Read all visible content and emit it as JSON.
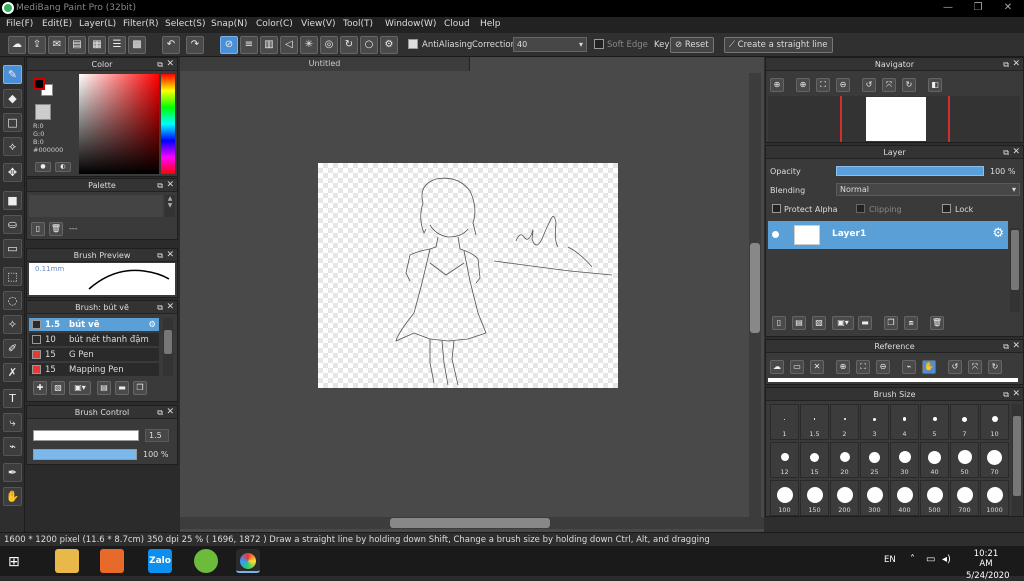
{
  "window": {
    "title": "MediBang Paint Pro (32bit)",
    "min": "—",
    "restore": "❐",
    "close": "✕"
  },
  "menu": [
    "File(F)",
    "Edit(E)",
    "Layer(L)",
    "Filter(R)",
    "Select(S)",
    "Snap(N)",
    "Color(C)",
    "View(V)",
    "Tool(T)",
    "Window(W)",
    "Cloud",
    "Help"
  ],
  "toolbar": {
    "antialias_label": "AntiAliasing",
    "correction_label": "Correction",
    "correction_value": "40",
    "soft_edge_label": "Soft Edge",
    "key_label": "Key",
    "reset_label": "Reset",
    "straight_line_label": "Create a straight line"
  },
  "document": {
    "tab_title": "Untitled"
  },
  "color_panel": {
    "title": "Color",
    "r": "R:0",
    "g": "G:0",
    "b": "B:0",
    "hex": "#000000",
    "foreground": "#000000",
    "background": "#ffffff"
  },
  "palette_panel": {
    "title": "Palette",
    "item": "---"
  },
  "brush_preview": {
    "title": "Brush Preview",
    "size": "0.11mm"
  },
  "brush_panel": {
    "title": "Brush: bút vẽ",
    "brushes": [
      {
        "size": "1.5",
        "name": "bút vẽ",
        "color": "#2a2a2a",
        "selected": true
      },
      {
        "size": "10",
        "name": "bút nét thanh đậm",
        "color": "#2a2a2a",
        "selected": false
      },
      {
        "size": "15",
        "name": "G Pen",
        "color": "#e53935",
        "selected": false
      },
      {
        "size": "15",
        "name": "Mapping Pen",
        "color": "#e53935",
        "selected": false
      }
    ]
  },
  "brush_control": {
    "title": "Brush Control",
    "size_value": "1.5",
    "opacity_value": "100 %"
  },
  "navigator": {
    "title": "Navigator"
  },
  "layer_panel": {
    "title": "Layer",
    "opacity_label": "Opacity",
    "opacity_value": "100 %",
    "blending_label": "Blending",
    "blending_value": "Normal",
    "protect_alpha": "Protect Alpha",
    "clipping": "Clipping",
    "lock": "Lock",
    "layer_name": "Layer1"
  },
  "reference": {
    "title": "Reference"
  },
  "brush_size": {
    "title": "Brush Size",
    "sizes": [
      "1",
      "1.5",
      "2",
      "3",
      "4",
      "5",
      "7",
      "10",
      "12",
      "15",
      "20",
      "25",
      "30",
      "40",
      "50",
      "70",
      "100",
      "150",
      "200",
      "300",
      "400",
      "500",
      "700",
      "1000"
    ]
  },
  "status": {
    "text": "1600 * 1200 pixel   (11.6 * 8.7cm)   350 dpi   25 %   ( 1696, 1872 )   Draw a straight line by holding down Shift, Change a brush size by holding down Ctrl, Alt, and dragging"
  },
  "taskbar": {
    "lang": "EN",
    "time": "10:21 AM",
    "date": "5/24/2020",
    "zalo": "Zalo"
  }
}
